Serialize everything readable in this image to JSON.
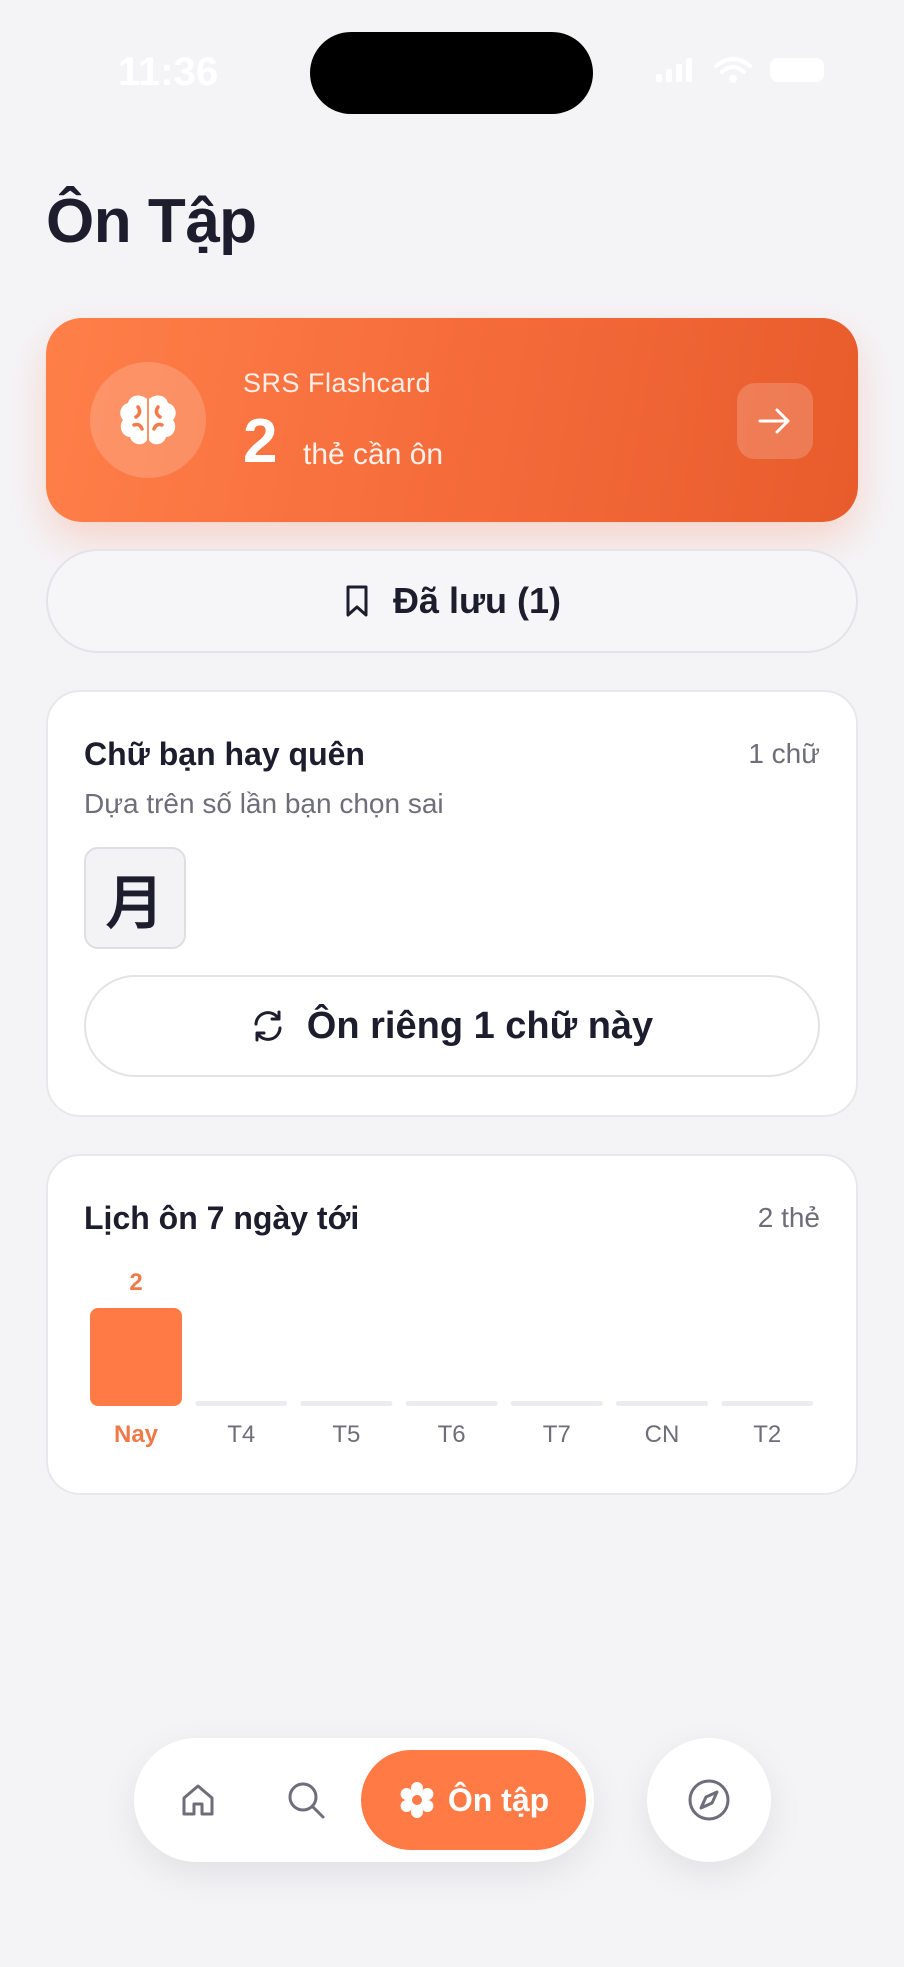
{
  "status_bar": {
    "time": "11:36"
  },
  "page": {
    "title": "Ôn Tập"
  },
  "srs_card": {
    "label": "SRS Flashcard",
    "count": "2",
    "unit": "thẻ cần ôn",
    "icon": "brain-icon",
    "arrow_icon": "arrow-right-icon"
  },
  "saved": {
    "label": "Đã lưu (1)",
    "icon": "bookmark-icon"
  },
  "forget_card": {
    "title": "Chữ bạn hay quên",
    "count": "1 chữ",
    "subtitle": "Dựa trên số lần bạn chọn sai",
    "kanji": [
      "月"
    ],
    "review_label": "Ôn riêng 1 chữ này",
    "review_icon": "refresh-icon"
  },
  "schedule_card": {
    "title": "Lịch ôn 7 ngày tới",
    "count": "2 thẻ"
  },
  "chart_data": {
    "type": "bar",
    "categories": [
      "Nay",
      "T4",
      "T5",
      "T6",
      "T7",
      "CN",
      "T2"
    ],
    "values": [
      2,
      0,
      0,
      0,
      0,
      0,
      0
    ],
    "ylim": [
      0,
      2
    ],
    "highlight_index": 0,
    "data_labels": [
      "2",
      "",
      "",
      "",
      "",
      "",
      ""
    ],
    "colors": {
      "active": "#ff7a45",
      "empty": "#ececf0",
      "label": "#6e6e7a",
      "active_label": "#f07a47"
    }
  },
  "nav": {
    "items": [
      {
        "name": "home",
        "icon": "home-icon"
      },
      {
        "name": "search",
        "icon": "search-icon"
      },
      {
        "name": "review",
        "icon": "gear-icon",
        "label": "Ôn tập",
        "active": true
      }
    ],
    "explore_icon": "compass-icon"
  },
  "colors": {
    "accent": "#ff7a45",
    "background": "#f4f4f7",
    "text": "#1d1d2e",
    "muted": "#6e6e7a"
  }
}
